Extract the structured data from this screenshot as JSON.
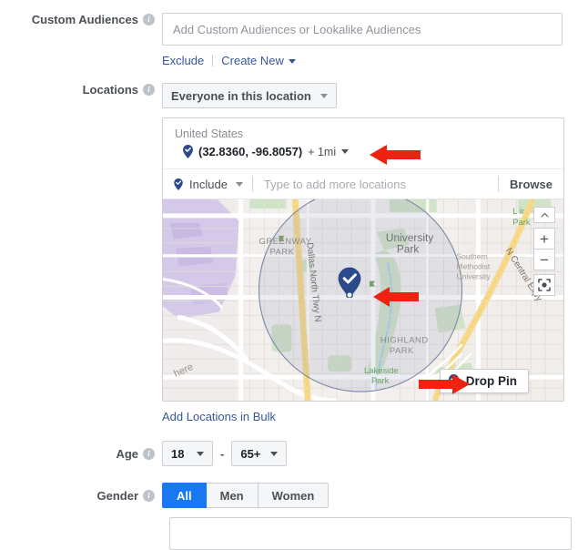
{
  "form": {
    "custom_audiences": {
      "label": "Custom Audiences",
      "info_icon": "info-icon",
      "placeholder": "Add Custom Audiences or Lookalike Audiences",
      "value": "",
      "links": {
        "exclude": "Exclude",
        "create_new": "Create New"
      }
    },
    "locations": {
      "label": "Locations",
      "info_icon": "info-icon",
      "scope_selector": {
        "value": "Everyone in this location",
        "caret_icon": "chevron-down-icon"
      },
      "panel": {
        "country": "United States",
        "entry": {
          "pin_icon": "map-pin-check-icon",
          "coordinates": "(32.8360, -96.8057)",
          "radius": "+ 1mi",
          "radius_caret_icon": "chevron-down-icon"
        },
        "search_bar": {
          "include_label": "Include",
          "include_pin_icon": "map-pin-check-icon",
          "include_caret_icon": "chevron-down-icon",
          "placeholder": "Type to add more locations",
          "value": "",
          "browse_label": "Browse"
        },
        "map": {
          "controls": {
            "collapse_icon": "chevron-up-icon",
            "zoom_in_label": "+",
            "zoom_out_label": "−",
            "recenter_icon": "recenter-icon"
          },
          "drop_pin_button": {
            "label": "Drop Pin",
            "pin_icon": "map-pin-check-icon"
          },
          "marker_icon": "map-pin-check-icon",
          "attribution": "here",
          "place_labels": [
            "GREENWAY PARK",
            "University Park",
            "Southern Methodist University",
            "HIGHLAND PARK",
            "Lakeside Park",
            "L   ir Park"
          ],
          "road_labels": [
            "Dallas North Tlwy N",
            "N Central Expy"
          ]
        }
      },
      "bulk_link": "Add Locations in Bulk"
    },
    "age": {
      "label": "Age",
      "info_icon": "info-icon",
      "min": "18",
      "max": "65+",
      "separator": "-",
      "caret_icon": "chevron-down-icon"
    },
    "gender": {
      "label": "Gender",
      "info_icon": "info-icon",
      "options": [
        "All",
        "Men",
        "Women"
      ],
      "selected": "All"
    }
  },
  "colors": {
    "accent_blue": "#1877f2",
    "link_blue": "#365899",
    "pin_blue": "#2c4b8e",
    "annotation_red": "#ee2211",
    "border_gray": "#ccd0d5",
    "label_gray": "#4b4f56",
    "placeholder_gray": "#90949c"
  },
  "annotations": {
    "arrows": [
      {
        "name": "arrow-pointing-at-radius-dropdown",
        "direction": "left"
      },
      {
        "name": "arrow-pointing-at-map-pin",
        "direction": "left"
      },
      {
        "name": "arrow-pointing-at-drop-pin-button",
        "direction": "right"
      }
    ]
  }
}
